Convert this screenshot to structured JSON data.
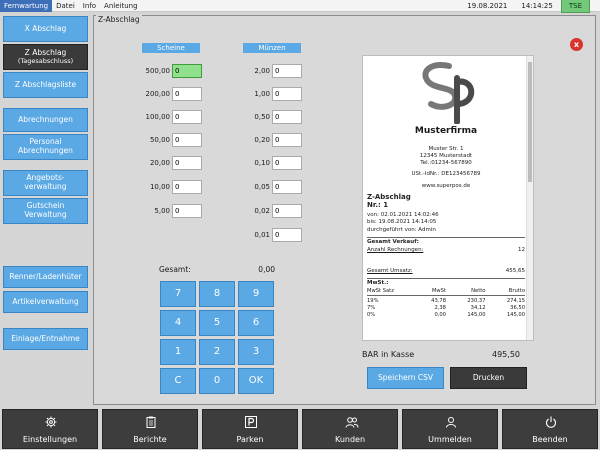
{
  "topbar": {
    "menu": [
      "Fernwartung",
      "Datei",
      "Info",
      "Anleitung"
    ],
    "date": "19.08.2021",
    "time": "14:14:25",
    "tse": "TSE"
  },
  "sidebar": {
    "items": [
      {
        "label": "X Abschlag"
      },
      {
        "label": "Z Abschlag",
        "sub": "(Tagesabschluss)"
      },
      {
        "label": "Z Abschlagsliste"
      },
      {
        "label": "Abrechnungen"
      },
      {
        "label": "Personal",
        "sub": "Abrechnungen"
      },
      {
        "label": "Angebots-",
        "sub": "verwaltung"
      },
      {
        "label": "Gutschein",
        "sub": "Verwaltung"
      },
      {
        "label": "Renner/Ladenhüter"
      },
      {
        "label": "Artikelverwaltung"
      },
      {
        "label": "Einlage/Entnahme"
      }
    ]
  },
  "panel": {
    "title": "Z-Abschlag",
    "scheine_header": "Scheine",
    "muenzen_header": "Münzen",
    "scheine": [
      {
        "label": "500,00",
        "value": "0"
      },
      {
        "label": "200,00",
        "value": "0"
      },
      {
        "label": "100,00",
        "value": "0"
      },
      {
        "label": "50,00",
        "value": "0"
      },
      {
        "label": "20,00",
        "value": "0"
      },
      {
        "label": "10,00",
        "value": "0"
      },
      {
        "label": "5,00",
        "value": "0"
      }
    ],
    "muenzen": [
      {
        "label": "2,00",
        "value": "0"
      },
      {
        "label": "1,00",
        "value": "0"
      },
      {
        "label": "0,50",
        "value": "0"
      },
      {
        "label": "0,20",
        "value": "0"
      },
      {
        "label": "0,10",
        "value": "0"
      },
      {
        "label": "0,05",
        "value": "0"
      },
      {
        "label": "0,02",
        "value": "0"
      },
      {
        "label": "0,01",
        "value": "0"
      }
    ],
    "gesamt_label": "Gesamt:",
    "gesamt_value": "0,00",
    "keypad": [
      "7",
      "8",
      "9",
      "4",
      "5",
      "6",
      "1",
      "2",
      "3",
      "C",
      "0",
      "OK"
    ],
    "close": "x"
  },
  "receipt": {
    "company": "Musterfirma",
    "address": [
      "Muster Str. 1",
      "12345 Musterstadt",
      "Tel.:01234-567890"
    ],
    "ustid": "USt.-IdNr.: DE123456789",
    "web": "www.superpos.de",
    "doc_title": "Z-Abschlag",
    "doc_nr": "Nr.: 1",
    "von": "von: 02.01.2021 14:02:46",
    "bis": "bis: 19.08.2021 14:14:05",
    "by": "durchgeführt von: Admin",
    "gesamt_verkauf": "Gesamt Verkauf:",
    "anzahl_label": "Anzahl Rechnungen:",
    "anzahl_value": "12",
    "umsatz_label": "Gesamt Umsatz:",
    "umsatz_value": "455,65",
    "mwst_title": "MwSt.:",
    "vat_headers": [
      "MwSt Satz",
      "MwSt",
      "Netto",
      "Brutto"
    ],
    "vat_rows": [
      [
        "19%",
        "43,78",
        "230,37",
        "274,15"
      ],
      [
        "7%",
        "2,38",
        "34,12",
        "36,50"
      ],
      [
        "0%",
        "0,00",
        "145,00",
        "145,00"
      ]
    ]
  },
  "bar": {
    "label": "BAR in Kasse",
    "value": "495,50"
  },
  "buttons": {
    "save": "Speichern CSV",
    "print": "Drucken"
  },
  "bottom": {
    "items": [
      {
        "label": "Einstellungen",
        "icon": "gear-icon"
      },
      {
        "label": "Berichte",
        "icon": "clipboard-icon"
      },
      {
        "label": "Parken",
        "icon": "parking-icon"
      },
      {
        "label": "Kunden",
        "icon": "users-icon"
      },
      {
        "label": "Ummelden",
        "icon": "user-switch-icon"
      },
      {
        "label": "Beenden",
        "icon": "power-icon"
      }
    ]
  }
}
